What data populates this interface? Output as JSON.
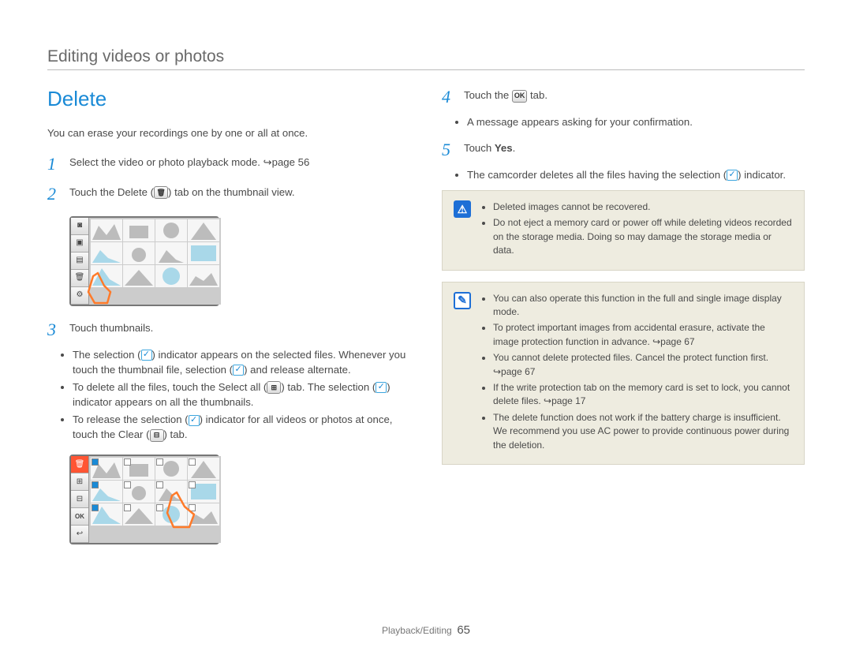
{
  "chapter_title": "Editing videos or photos",
  "section_title": "Delete",
  "intro": "You can erase your recordings one by one or all at once.",
  "steps": {
    "s1": {
      "num": "1",
      "text_a": "Select the video or photo playback mode. ",
      "arrow_ref": "↪page 56"
    },
    "s2": {
      "num": "2",
      "text_a": "Touch the Delete (",
      "text_b": ") tab on the thumbnail view."
    },
    "s3": {
      "num": "3",
      "text": "Touch thumbnails."
    },
    "s3_bullets": [
      {
        "a": "The selection (",
        "b": ") indicator appears on the selected files. Whenever you touch the thumbnail file, selection (",
        "c": ") and release alternate."
      },
      {
        "a": "To delete all the files, touch the Select all (",
        "b": ") tab. The selection (",
        "c": ") indicator appears on all the thumbnails."
      },
      {
        "a": "To release the selection (",
        "b": ") indicator for all videos or photos at once, touch the Clear (",
        "c": ") tab."
      }
    ],
    "s4": {
      "num": "4",
      "text_a": "Touch the ",
      "ok": "OK",
      "text_b": " tab."
    },
    "s4_bullets": [
      "A message appears asking for your confirmation."
    ],
    "s5": {
      "num": "5",
      "text_a": "Touch ",
      "yes": "Yes",
      "text_b": "."
    },
    "s5_bullets": [
      {
        "a": "The camcorder deletes all the files having the selection (",
        "b": ") indicator."
      }
    ]
  },
  "warning_notes": [
    "Deleted images cannot be recovered.",
    "Do not eject a memory card or power off while deleting videos recorded on the storage media. Doing so may damage the storage media or data."
  ],
  "info_notes": [
    "You can also operate this function in the full and single image display mode.",
    "To protect important images from accidental erasure, activate the image protection function in advance. ↪page 67",
    "You cannot delete protected files. Cancel the protect function first. ↪page 67",
    "If the write protection tab on the memory card is set to lock, you cannot delete files. ↪page 17",
    "The delete function does not work if the battery charge is insufficient. We recommend you use AC power to provide continuous power during the deletion."
  ],
  "icons": {
    "trash": "🗑",
    "ok": "OK",
    "selectall": "⊞",
    "clear": "⊟",
    "back": "↩",
    "check": "✓"
  },
  "footer": {
    "section": "Playback/Editing",
    "page": "65"
  }
}
